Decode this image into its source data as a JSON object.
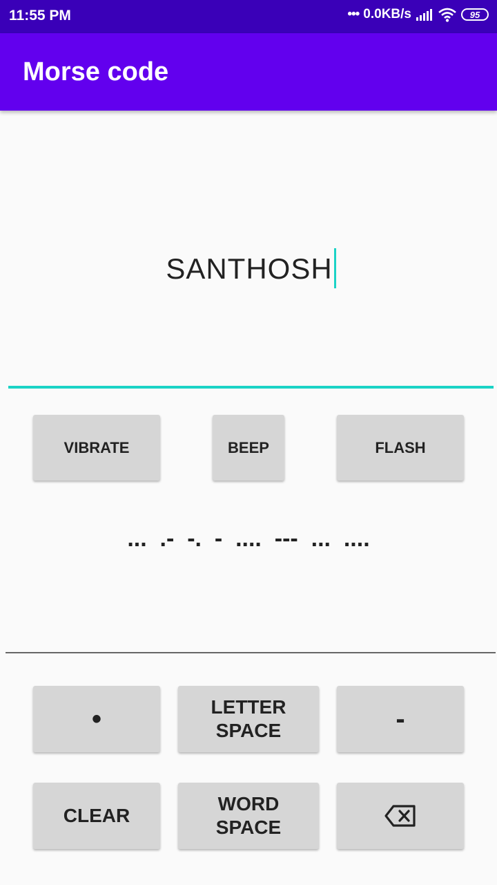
{
  "status_bar": {
    "time": "11:55 PM",
    "net_speed": "0.0KB/s",
    "battery": "95",
    "icons": [
      "dots-icon",
      "signal-icon",
      "wifi-icon",
      "battery-icon"
    ]
  },
  "app_bar": {
    "title": "Morse code"
  },
  "input": {
    "value": "SANTHOSH"
  },
  "output_buttons": {
    "vibrate": "VIBRATE",
    "beep": "BEEP",
    "flash": "FLASH"
  },
  "morse_output": "...  .-  -.  -  ....  ---  ...  ....",
  "keypad": {
    "dot": "•",
    "letter_space": "LETTER SPACE",
    "dash": "-",
    "clear": "CLEAR",
    "word_space": "WORD SPACE",
    "backspace_icon": "backspace-icon"
  },
  "colors": {
    "status_bar": "#3a00b8",
    "app_bar": "#6200ee",
    "accent": "#1bd3c6",
    "button": "#d6d6d6"
  }
}
